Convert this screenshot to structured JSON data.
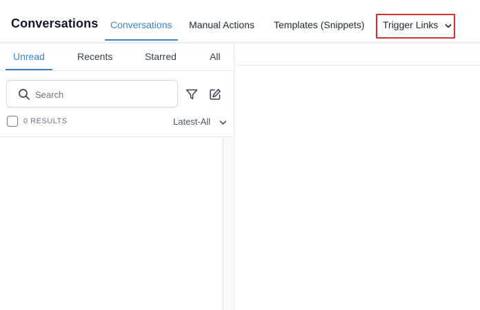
{
  "header": {
    "title": "Conversations",
    "tabs": [
      {
        "label": "Conversations",
        "active": true
      },
      {
        "label": "Manual Actions",
        "active": false
      },
      {
        "label": "Templates (Snippets)",
        "active": false
      }
    ],
    "dropdown": {
      "label": "Trigger Links",
      "icon": "chevron-down-icon"
    }
  },
  "sidebar": {
    "tabs": [
      {
        "label": "Unread",
        "active": true
      },
      {
        "label": "Recents",
        "active": false
      },
      {
        "label": "Starred",
        "active": false
      },
      {
        "label": "All",
        "active": false
      }
    ],
    "search": {
      "placeholder": "Search",
      "value": "",
      "icon": "search-icon"
    },
    "tools": {
      "filter_icon": "filter-icon",
      "compose_icon": "compose-icon"
    },
    "results_label": "0 RESULTS",
    "sort": {
      "selected": "Latest-All",
      "icon": "chevron-down-icon"
    }
  },
  "colors": {
    "accent": "#3b82c4",
    "highlight_border": "#d32f2f",
    "divider": "#e5e7eb",
    "text": "#1f2937"
  }
}
